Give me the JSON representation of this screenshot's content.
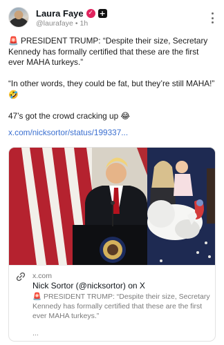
{
  "author": {
    "display_name": "Laura Faye",
    "handle": "@laurafaye",
    "separator": "•",
    "time": "1h",
    "verify_icon": "✓",
    "plus_icon": "+"
  },
  "post": {
    "paragraphs": [
      "🚨 PRESIDENT TRUMP: “Despite their size, Secretary Kennedy has formally certified that these are the first ever MAHA turkeys.”",
      "“In other words, they could be fat, but they’re still MAHA!” 🤣",
      "47’s got the crowd cracking up 😂"
    ],
    "link_text": "x.com/nicksortor/status/199337..."
  },
  "card": {
    "domain": "x.com",
    "title": "Nick Sortor (@nicksortor) on X",
    "description": "🚨 PRESIDENT TRUMP: “Despite their size, Secretary Kennedy has formally certified that these are the first ever MAHA turkeys.”",
    "ellipsis": "..."
  },
  "colors": {
    "link": "#3a6fd0",
    "badge": "#e0245e",
    "meta_gray": "#8b8b8b"
  },
  "icons": {
    "more": "more-vertical-icon",
    "link": "link-chain-icon"
  }
}
